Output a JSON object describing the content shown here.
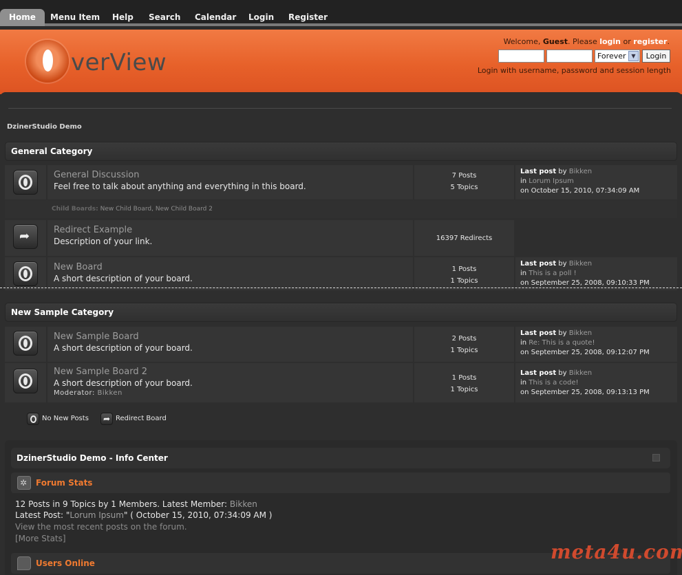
{
  "nav": {
    "items": [
      "Home",
      "Menu Item",
      "Help",
      "Search",
      "Calendar",
      "Login",
      "Register"
    ]
  },
  "header": {
    "logo_text": "verView",
    "welcome_prefix": "Welcome, ",
    "guest": "Guest",
    "please": ". Please ",
    "login_link": "login",
    "or": " or ",
    "register_link": "register",
    "period": ".",
    "session_option": "Forever",
    "login_button": "Login",
    "hint": "Login with username, password and session length"
  },
  "breadcrumb": "DzinerStudio Demo",
  "categories": [
    {
      "title": "General Category",
      "boards": [
        {
          "name": "General Discussion",
          "desc": "Feel free to talk about anything and everything in this board.",
          "stat1": "7 Posts",
          "stat2": "5 Topics",
          "last_label": "Last post",
          "by": " by ",
          "author": "Bikken",
          "in": "in ",
          "topic": "Lorum Ipsum",
          "date": "on October 15, 2010, 07:34:09 AM",
          "child_label": "Child Boards:",
          "children": [
            "New Child Board",
            "New Child Board 2"
          ]
        },
        {
          "name": "Redirect Example",
          "desc": "Description of your link.",
          "stat1": "16397 Redirects"
        },
        {
          "name": "New Board",
          "desc": "A short description of your board.",
          "stat1": "1 Posts",
          "stat2": "1 Topics",
          "last_label": "Last post",
          "by": " by ",
          "author": "Bikken",
          "in": "in ",
          "topic": "This is a poll !",
          "date": "on September 25, 2008, 09:10:33 PM"
        }
      ]
    },
    {
      "title": "New Sample Category",
      "boards": [
        {
          "name": "New Sample Board",
          "desc": "A short description of your board.",
          "stat1": "2 Posts",
          "stat2": "1 Topics",
          "last_label": "Last post",
          "by": " by ",
          "author": "Bikken",
          "in": "in ",
          "topic": "Re: This is a quote!",
          "date": "on September 25, 2008, 09:12:07 PM"
        },
        {
          "name": "New Sample Board 2",
          "desc": "A short description of your board.",
          "moderator_label": "Moderator: ",
          "moderator": "Bikken",
          "stat1": "1 Posts",
          "stat2": "1 Topics",
          "last_label": "Last post",
          "by": " by ",
          "author": "Bikken",
          "in": "in ",
          "topic": "This is a code!",
          "date": "on September 25, 2008, 09:13:13 PM"
        }
      ]
    }
  ],
  "legend": {
    "no_new": "No New Posts",
    "redirect": "Redirect Board"
  },
  "info_center": {
    "title": "DzinerStudio Demo - Info Center",
    "forum_stats": "Forum Stats",
    "stats_line1_a": "12 Posts in 9 Topics by 1 Members. Latest Member: ",
    "latest_member": "Bikken",
    "stats_line2_a": "Latest Post: \"",
    "latest_post": "Lorum Ipsum",
    "stats_line2_b": "\" ( October 15, 2010, 07:34:09 AM )",
    "recent_link": "View the most recent posts on the forum.",
    "more_stats": "[More Stats]",
    "users_online": "Users Online"
  },
  "watermark": "meta4u.com",
  "colors": {
    "header_orange": "#e7612a",
    "accent_orange": "#f07a30",
    "body_bg": "#2b2b2b"
  }
}
